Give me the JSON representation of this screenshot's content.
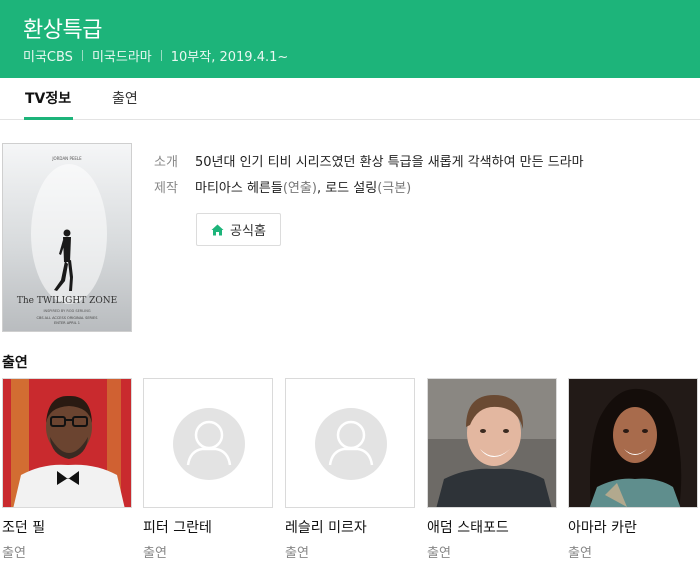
{
  "header": {
    "title": "환상특급",
    "meta": [
      "미국CBS",
      "미국드라마",
      "10부작, 2019.4.1~"
    ],
    "bg_color": "#1db47a"
  },
  "tabs": [
    {
      "label": "TV정보",
      "active": true
    },
    {
      "label": "출연",
      "active": false
    }
  ],
  "poster": {
    "top_text": "JORDAN PEELE",
    "title": "The TWILIGHT ZONE",
    "subtitle": "INSPIRED BY ROD SERLING",
    "network": "CBS ALL ACCESS ORIGINAL SERIES",
    "date": "ENTER APRIL 1"
  },
  "info": {
    "intro_label": "소개",
    "intro_value": "50년대 인기 티비 시리즈였던 환상 특급을 새롭게 각색하여 만든 드라마",
    "production_label": "제작",
    "production_name1": "마티아스 헤른들",
    "production_role1": "(연출)",
    "production_sep": ", ",
    "production_name2": "로드 설링",
    "production_role2": "(극본)"
  },
  "home_button": {
    "label": "공식홈",
    "icon": "home-icon"
  },
  "cast_section": {
    "title": "출연"
  },
  "cast": [
    {
      "name": "조던 필",
      "role": "출연",
      "photo": "photo"
    },
    {
      "name": "피터 그란테",
      "role": "출연",
      "photo": "placeholder"
    },
    {
      "name": "레슬리 미르자",
      "role": "출연",
      "photo": "placeholder"
    },
    {
      "name": "애덤 스태포드",
      "role": "출연",
      "photo": "photo"
    },
    {
      "name": "아마라 카란",
      "role": "출연",
      "photo": "photo"
    }
  ]
}
